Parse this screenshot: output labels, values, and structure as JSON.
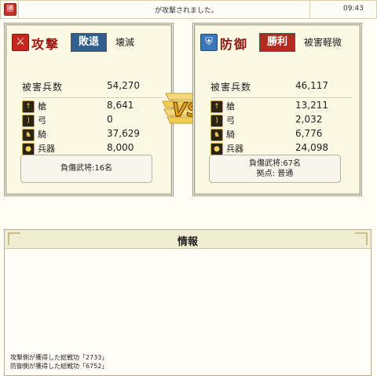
{
  "top_bar": {
    "badge": "勝",
    "message": "が攻撃されました。",
    "time": "09:43"
  },
  "attacker": {
    "side_label": "攻撃",
    "result": "敗退",
    "summary": "壊滅",
    "total_label": "被害兵数",
    "total_value": "54,270",
    "units": [
      {
        "icon": "spear-icon",
        "label": "槍",
        "value": "8,641"
      },
      {
        "icon": "bow-icon",
        "label": "弓",
        "value": "0"
      },
      {
        "icon": "horse-icon",
        "label": "騎",
        "value": "37,629"
      },
      {
        "icon": "siege-icon",
        "label": "兵器",
        "value": "8,000"
      }
    ],
    "info_lines": [
      "負傷武将:16名"
    ]
  },
  "defender": {
    "side_label": "防御",
    "result": "勝利",
    "summary": "被害軽微",
    "total_label": "被害兵数",
    "total_value": "46,117",
    "units": [
      {
        "icon": "spear-icon",
        "label": "槍",
        "value": "13,211"
      },
      {
        "icon": "bow-icon",
        "label": "弓",
        "value": "2,032"
      },
      {
        "icon": "horse-icon",
        "label": "騎",
        "value": "6,776"
      },
      {
        "icon": "siege-icon",
        "label": "兵器",
        "value": "24,098"
      }
    ],
    "info_lines": [
      "負傷武将:67名",
      "拠点: 普通"
    ]
  },
  "vs_label": "VS",
  "info": {
    "title": "情報",
    "log": [
      "攻撃側が獲得した総戦功「2733」",
      "防御側が獲得した総戦功「6752」"
    ]
  },
  "colors": {
    "attacker_accent": "#c4261e",
    "defender_accent": "#3a76b8",
    "lost_badge": "#2f5f8f",
    "won_badge": "#b42a1f",
    "vs_gold": "#e0a21a"
  }
}
